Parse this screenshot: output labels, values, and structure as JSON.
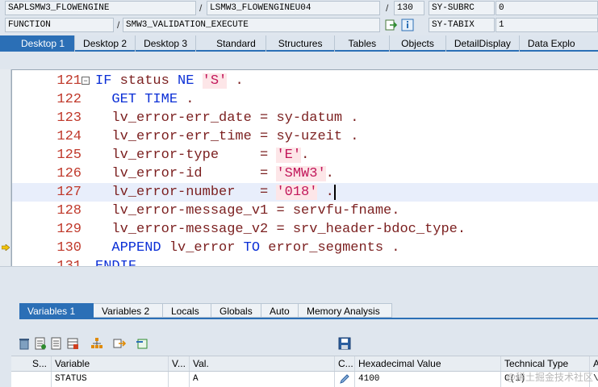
{
  "header": {
    "row1": {
      "program": "SAPLSMW3_FLOWENGINE",
      "slash": "/",
      "include": "LSMW3_FLOWENGINEU04",
      "line_no": "130",
      "sysfield_name": "SY-SUBRC",
      "sysfield_value": "0"
    },
    "row2": {
      "type": "FUNCTION",
      "slash": "/",
      "name": "SMW3_VALIDATION_EXECUTE",
      "sysfield_name": "SY-TABIX",
      "sysfield_value": "1"
    }
  },
  "tabs": [
    "Desktop 1",
    "Desktop 2",
    "Desktop 3",
    "Standard",
    "Structures",
    "Tables",
    "Objects",
    "DetailDisplay",
    "Data Explo"
  ],
  "code_lines": [
    {
      "num": "121",
      "indent": "",
      "parts": [
        [
          "kw",
          "IF"
        ],
        [
          "v",
          " status "
        ],
        [
          "kw",
          "NE"
        ],
        [
          "v",
          " "
        ],
        [
          "s",
          "'S'"
        ],
        [
          "v",
          " ."
        ]
      ]
    },
    {
      "num": "122",
      "indent": "  ",
      "parts": [
        [
          "kw",
          "GET TIME"
        ],
        [
          "v",
          " ."
        ]
      ]
    },
    {
      "num": "123",
      "indent": "  ",
      "parts": [
        [
          "v",
          "lv_error-err_date = sy-datum ."
        ]
      ]
    },
    {
      "num": "124",
      "indent": "  ",
      "parts": [
        [
          "v",
          "lv_error-err_time = sy-uzeit ."
        ]
      ]
    },
    {
      "num": "125",
      "indent": "  ",
      "parts": [
        [
          "v",
          "lv_error-type     = "
        ],
        [
          "s",
          "'E'"
        ],
        [
          "v",
          "."
        ]
      ]
    },
    {
      "num": "126",
      "indent": "  ",
      "parts": [
        [
          "v",
          "lv_error-id       = "
        ],
        [
          "s",
          "'SMW3'"
        ],
        [
          "v",
          "."
        ]
      ]
    },
    {
      "num": "127",
      "indent": "  ",
      "parts": [
        [
          "v",
          "lv_error-number   = "
        ],
        [
          "s",
          "'018'"
        ],
        [
          "v",
          " ."
        ]
      ]
    },
    {
      "num": "128",
      "indent": "  ",
      "parts": [
        [
          "v",
          "lv_error-message_v1 = servfu-fname."
        ]
      ]
    },
    {
      "num": "129",
      "indent": "  ",
      "parts": [
        [
          "v",
          "lv_error-message_v2 = srv_header-bdoc_type."
        ]
      ]
    },
    {
      "num": "130",
      "indent": "  ",
      "parts": [
        [
          "kw",
          "APPEND"
        ],
        [
          "v",
          " lv_error "
        ],
        [
          "kw",
          "TO"
        ],
        [
          "v",
          " error_segments ."
        ]
      ]
    },
    {
      "num": "131",
      "indent": "",
      "parts": [
        [
          "kw",
          "ENDIF"
        ],
        [
          "v",
          "."
        ]
      ]
    }
  ],
  "bottom_tabs": [
    "Variables 1",
    "Variables 2",
    "Locals",
    "Globals",
    "Auto",
    "Memory Analysis"
  ],
  "var_table": {
    "columns": [
      "S...",
      "Variable",
      "V...",
      "Val.",
      "C...",
      "Hexadecimal Value",
      "Technical Type",
      "A"
    ],
    "rows": [
      {
        "s": "",
        "variable": "STATUS",
        "v": "",
        "val": "A",
        "c": "",
        "hex": "4100",
        "type": "C(1)",
        "a": "\\T"
      }
    ]
  },
  "watermark": "@稀土掘金技术社区",
  "colors": {
    "accent": "#2b6fb6",
    "keyword": "#0b2fd6",
    "identifier": "#7b1f1f",
    "string": "#c2185b",
    "line_number": "#c0392b"
  }
}
